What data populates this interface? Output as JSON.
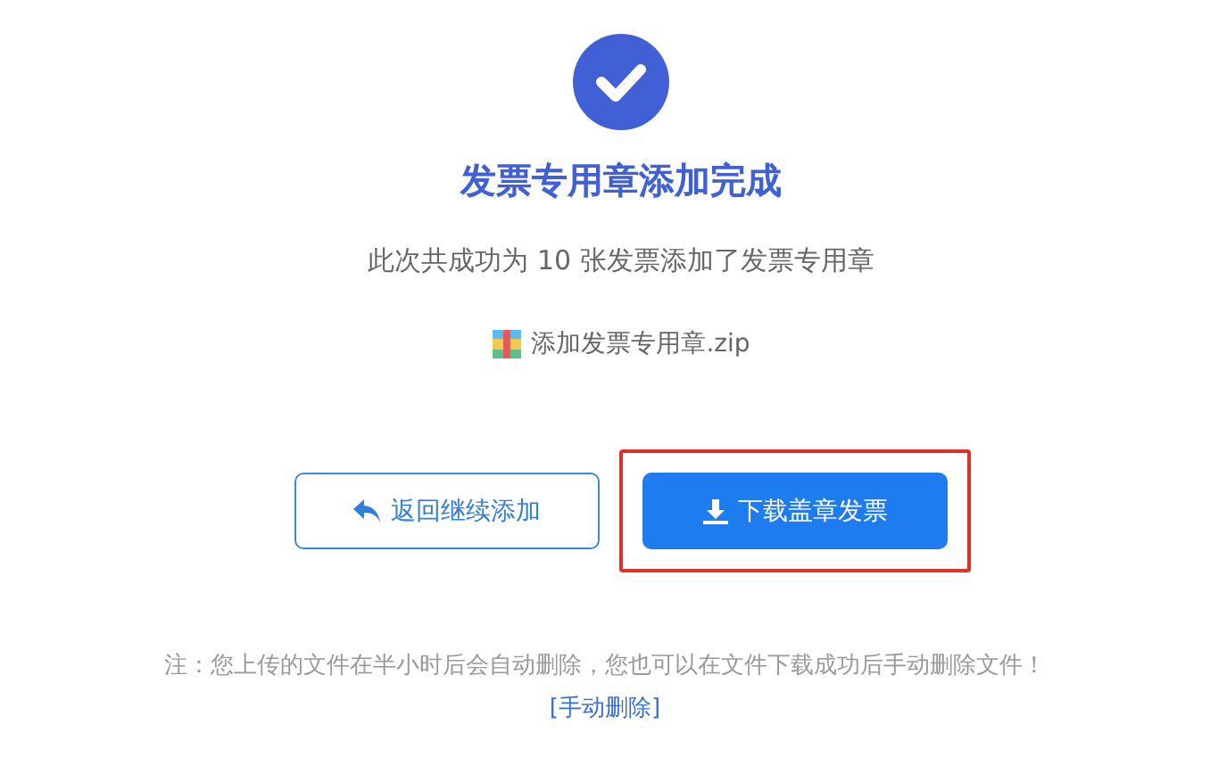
{
  "title": "发票专用章添加完成",
  "summary": "此次共成功为 10 张发票添加了发票专用章",
  "file": {
    "name": "添加发票专用章.zip"
  },
  "buttons": [
    {
      "kind": "back",
      "label": "返回继续添加",
      "highlighted": false
    },
    {
      "kind": "download",
      "label": "下载盖章发票",
      "highlighted": true
    }
  ],
  "note": "注：您上传的文件在半小时后会自动删除，您也可以在文件下载成功后手动删除文件！",
  "delete_link": "[手动删除]"
}
